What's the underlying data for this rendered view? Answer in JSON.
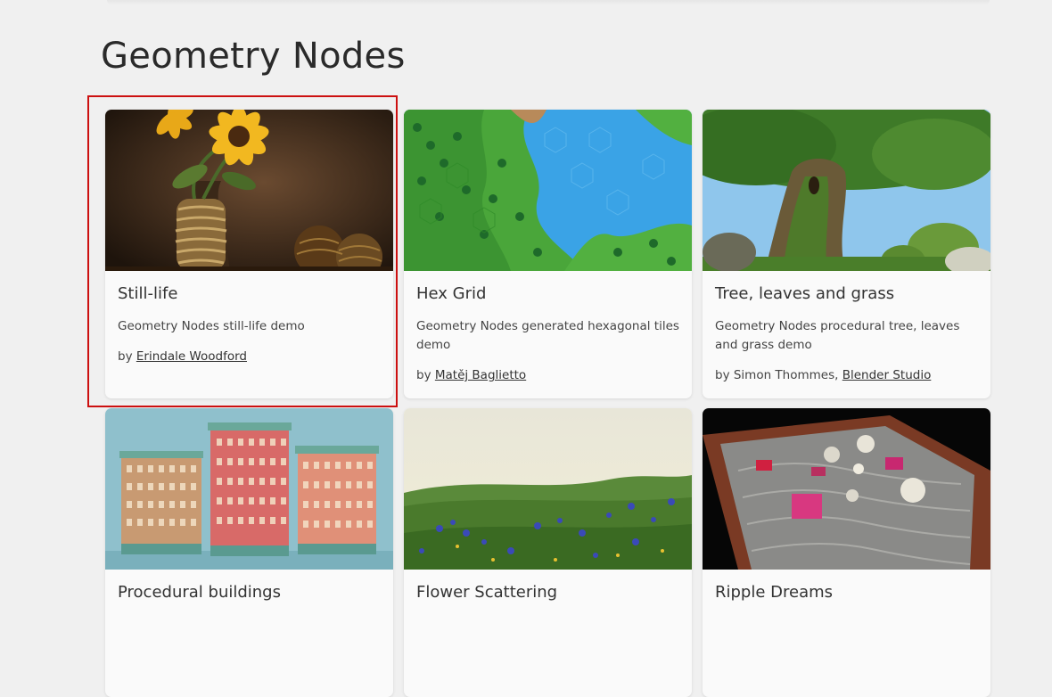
{
  "section": {
    "title": "Geometry Nodes"
  },
  "cards": [
    {
      "title": "Still-life",
      "description": "Geometry Nodes still-life demo",
      "by": "by",
      "authors": [
        {
          "name": "Erindale Woodford",
          "link": true
        }
      ],
      "thumbnail": "sunflower-vase-image"
    },
    {
      "title": "Hex Grid",
      "description": "Geometry Nodes generated hexagonal tiles demo",
      "by": "by",
      "authors": [
        {
          "name": "Matěj Baglietto",
          "link": true
        }
      ],
      "thumbnail": "hexagonal-terrain-image"
    },
    {
      "title": "Tree, leaves and grass",
      "description": "Geometry Nodes procedural tree, leaves and grass demo",
      "by": "by",
      "authors": [
        {
          "name": "Simon Thommes,",
          "link": false
        },
        {
          "name": "Blender Studio",
          "link": true
        }
      ],
      "thumbnail": "mossy-tree-image"
    },
    {
      "title": "Procedural buildings",
      "thumbnail": "buildings-image"
    },
    {
      "title": "Flower Scattering",
      "thumbnail": "flower-field-image"
    },
    {
      "title": "Ripple Dreams",
      "thumbnail": "water-box-image"
    }
  ],
  "highlight_color": "#cc1010"
}
